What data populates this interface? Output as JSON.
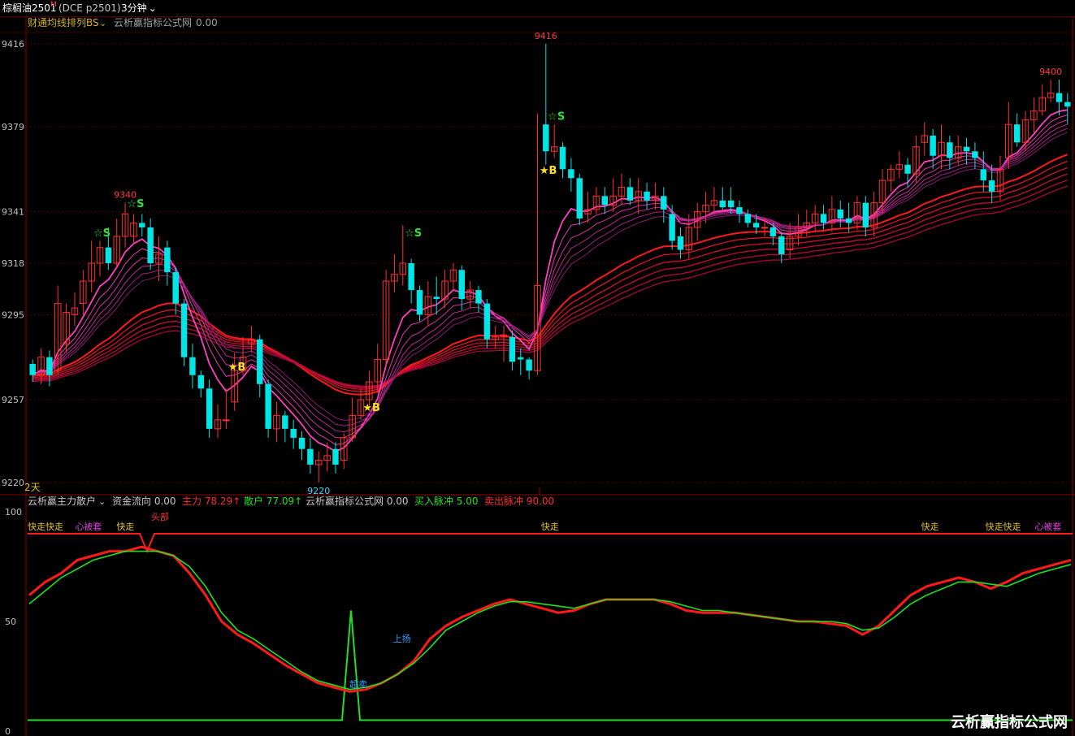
{
  "header": {
    "symbol": "棕榈油2501",
    "symbol_mark": "M",
    "contract": "(DCE  p2501)",
    "period": "3分钟"
  },
  "price_panel": {
    "indicator_name": "财通均线排列BS",
    "source_name": "云析赢指标公式网",
    "source_value": "0.00",
    "range_label": "2天"
  },
  "osc_panel": {
    "indicator_name": "云析赢主力散户",
    "legend": [
      {
        "label": "资金流向",
        "value": "0.00",
        "color": "#c8c8c8"
      },
      {
        "label": "主力",
        "value": "78.29↑",
        "color": "#ff2a2a"
      },
      {
        "label": "散户",
        "value": "77.09↑",
        "color": "#20e020"
      },
      {
        "label": "云析赢指标公式网",
        "value": "0.00",
        "color": "#c8c8c8"
      },
      {
        "label": "买入脉冲",
        "value": "5.00",
        "color": "#20e020"
      },
      {
        "label": "卖出脉冲",
        "value": "90.00",
        "color": "#ff2a2a"
      }
    ],
    "annotations": [
      {
        "text": "快走快走",
        "x": 0,
        "color": "#e0c030"
      },
      {
        "text": "心被套",
        "x": 4.8,
        "color": "#e040e0"
      },
      {
        "text": "快走",
        "x": 9,
        "color": "#e0c030"
      },
      {
        "text": "头部",
        "x": 12.5,
        "color": "#ff3030"
      },
      {
        "text": "快走",
        "x": 52,
        "color": "#e0c030"
      },
      {
        "text": "上扬",
        "x": 37,
        "color": "#30a0ff"
      },
      {
        "text": "超卖",
        "x": 32.6,
        "color": "#30a0ff"
      },
      {
        "text": "快走",
        "x": 90.5,
        "color": "#e0c030"
      },
      {
        "text": "快走快走",
        "x": 97,
        "color": "#e0c030"
      },
      {
        "text": "心被套",
        "x": 102,
        "color": "#e040e0"
      }
    ]
  },
  "watermark": "云析赢指标公式网",
  "chart_data": [
    {
      "type": "candlestick",
      "title": "财通均线排列BS",
      "yticks": [
        9220,
        9257,
        9295,
        9318,
        9341,
        9379,
        9416
      ],
      "ylim": [
        9220,
        9420
      ],
      "candles": [
        [
          9273,
          9268,
          9275,
          9265
        ],
        [
          9268,
          9276,
          9280,
          9264
        ],
        [
          9276,
          9268,
          9279,
          9263
        ],
        [
          9270,
          9300,
          9308,
          9268
        ],
        [
          9282,
          9296,
          9300,
          9278
        ],
        [
          9295,
          9298,
          9305,
          9290
        ],
        [
          9300,
          9310,
          9315,
          9295
        ],
        [
          9310,
          9318,
          9328,
          9305
        ],
        [
          9318,
          9325,
          9328,
          9312
        ],
        [
          9325,
          9318,
          9334,
          9315
        ],
        [
          9318,
          9330,
          9338,
          9316
        ],
        [
          9330,
          9340,
          9345,
          9325
        ],
        [
          9330,
          9336,
          9340,
          9327
        ],
        [
          9336,
          9334,
          9340,
          9330
        ],
        [
          9334,
          9318,
          9338,
          9315
        ],
        [
          9318,
          9322,
          9330,
          9310
        ],
        [
          9325,
          9314,
          9328,
          9308
        ],
        [
          9314,
          9300,
          9316,
          9295
        ],
        [
          9300,
          9276,
          9302,
          9272
        ],
        [
          9276,
          9268,
          9282,
          9262
        ],
        [
          9268,
          9262,
          9270,
          9258
        ],
        [
          9262,
          9244,
          9266,
          9240
        ],
        [
          9244,
          9248,
          9255,
          9240
        ],
        [
          9248,
          9248,
          9262,
          9244
        ],
        [
          9256,
          9270,
          9278,
          9252
        ],
        [
          9270,
          9276,
          9285,
          9268
        ],
        [
          9282,
          9284,
          9290,
          9278
        ],
        [
          9284,
          9264,
          9286,
          9258
        ],
        [
          9264,
          9244,
          9266,
          9240
        ],
        [
          9244,
          9250,
          9256,
          9238
        ],
        [
          9250,
          9244,
          9252,
          9238
        ],
        [
          9244,
          9240,
          9248,
          9235
        ],
        [
          9240,
          9235,
          9243,
          9230
        ],
        [
          9235,
          9228,
          9240,
          9224
        ],
        [
          9228,
          9230,
          9234,
          9220
        ],
        [
          9230,
          9232,
          9238,
          9225
        ],
        [
          9235,
          9228,
          9238,
          9224
        ],
        [
          9230,
          9240,
          9242,
          9226
        ],
        [
          9240,
          9250,
          9258,
          9238
        ],
        [
          9250,
          9257,
          9262,
          9248
        ],
        [
          9257,
          9265,
          9270,
          9254
        ],
        [
          9265,
          9275,
          9282,
          9260
        ],
        [
          9275,
          9310,
          9315,
          9272
        ],
        [
          9310,
          9313,
          9322,
          9305
        ],
        [
          9313,
          9318,
          9335,
          9308
        ],
        [
          9318,
          9306,
          9320,
          9300
        ],
        [
          9306,
          9295,
          9308,
          9292
        ],
        [
          9295,
          9303,
          9310,
          9290
        ],
        [
          9303,
          9302,
          9312,
          9295
        ],
        [
          9302,
          9310,
          9315,
          9298
        ],
        [
          9310,
          9315,
          9318,
          9306
        ],
        [
          9315,
          9302,
          9317,
          9297
        ],
        [
          9302,
          9306,
          9310,
          9298
        ],
        [
          9306,
          9300,
          9308,
          9296
        ],
        [
          9300,
          9284,
          9302,
          9280
        ],
        [
          9284,
          9285,
          9290,
          9280
        ],
        [
          9285,
          9286,
          9290,
          9274
        ],
        [
          9285,
          9274,
          9288,
          9270
        ],
        [
          9276,
          9275,
          9280,
          9268
        ],
        [
          9275,
          9270,
          9276,
          9266
        ],
        [
          9270,
          9308,
          9385,
          9268
        ],
        [
          9380,
          9368,
          9416,
          9362
        ],
        [
          9368,
          9370,
          9380,
          9365
        ],
        [
          9370,
          9360,
          9372,
          9356
        ],
        [
          9360,
          9356,
          9365,
          9350
        ],
        [
          9356,
          9338,
          9358,
          9335
        ],
        [
          9340,
          9342,
          9350,
          9336
        ],
        [
          9342,
          9348,
          9352,
          9340
        ],
        [
          9348,
          9344,
          9352,
          9340
        ],
        [
          9344,
          9348,
          9356,
          9341
        ],
        [
          9348,
          9352,
          9358,
          9344
        ],
        [
          9352,
          9346,
          9356,
          9344
        ],
        [
          9346,
          9350,
          9356,
          9340
        ],
        [
          9350,
          9346,
          9354,
          9342
        ],
        [
          9346,
          9348,
          9354,
          9342
        ],
        [
          9348,
          9342,
          9352,
          9336
        ],
        [
          9340,
          9328,
          9344,
          9324
        ],
        [
          9330,
          9324,
          9334,
          9320
        ],
        [
          9324,
          9334,
          9340,
          9320
        ],
        [
          9334,
          9341,
          9345,
          9328
        ],
        [
          9341,
          9344,
          9350,
          9336
        ],
        [
          9344,
          9346,
          9352,
          9340
        ],
        [
          9346,
          9343,
          9352,
          9342
        ],
        [
          9346,
          9343,
          9352,
          9340
        ],
        [
          9343,
          9340,
          9346,
          9336
        ],
        [
          9340,
          9336,
          9342,
          9334
        ],
        [
          9336,
          9334,
          9340,
          9331
        ],
        [
          9334,
          9334,
          9338,
          9330
        ],
        [
          9334,
          9330,
          9336,
          9326
        ],
        [
          9330,
          9322,
          9332,
          9318
        ],
        [
          9324,
          9330,
          9336,
          9320
        ],
        [
          9330,
          9334,
          9340,
          9326
        ],
        [
          9334,
          9336,
          9342,
          9330
        ],
        [
          9336,
          9340,
          9344,
          9332
        ],
        [
          9340,
          9336,
          9344,
          9333
        ],
        [
          9336,
          9342,
          9348,
          9332
        ],
        [
          9342,
          9338,
          9346,
          9334
        ],
        [
          9338,
          9336,
          9345,
          9332
        ],
        [
          9336,
          9345,
          9348,
          9333
        ],
        [
          9345,
          9334,
          9348,
          9330
        ],
        [
          9334,
          9345,
          9350,
          9330
        ],
        [
          9345,
          9355,
          9360,
          9340
        ],
        [
          9355,
          9360,
          9362,
          9350
        ],
        [
          9360,
          9362,
          9368,
          9356
        ],
        [
          9362,
          9358,
          9365,
          9352
        ],
        [
          9358,
          9370,
          9375,
          9354
        ],
        [
          9372,
          9375,
          9381,
          9366
        ],
        [
          9375,
          9366,
          9378,
          9360
        ],
        [
          9366,
          9372,
          9380,
          9360
        ],
        [
          9372,
          9365,
          9375,
          9360
        ],
        [
          9365,
          9370,
          9375,
          9362
        ],
        [
          9370,
          9368,
          9374,
          9362
        ],
        [
          9368,
          9365,
          9372,
          9360
        ],
        [
          9360,
          9355,
          9368,
          9350
        ],
        [
          9355,
          9350,
          9362,
          9345
        ],
        [
          9350,
          9360,
          9366,
          9346
        ],
        [
          9365,
          9380,
          9390,
          9360
        ],
        [
          9380,
          9372,
          9385,
          9370
        ],
        [
          9372,
          9382,
          9386,
          9368
        ],
        [
          9382,
          9386,
          9392,
          9376
        ],
        [
          9386,
          9392,
          9398,
          9384
        ],
        [
          9392,
          9394,
          9400,
          9390
        ],
        [
          9394,
          9390,
          9400,
          9384
        ],
        [
          9390,
          9388,
          9394,
          9380
        ]
      ],
      "highlights": [
        {
          "kind": "high",
          "label": "9416",
          "candle": 61
        },
        {
          "kind": "high",
          "label": "9340",
          "candle": 11
        },
        {
          "kind": "low",
          "label": "9220",
          "candle": 34
        },
        {
          "kind": "high",
          "label": "9400",
          "candle": 121
        }
      ],
      "signals": [
        {
          "type": "S",
          "candle": 8,
          "price": 9330
        },
        {
          "type": "S",
          "candle": 12,
          "price": 9343
        },
        {
          "type": "B",
          "candle": 24,
          "price": 9270
        },
        {
          "type": "B",
          "candle": 40,
          "price": 9252
        },
        {
          "type": "S",
          "candle": 45,
          "price": 9330
        },
        {
          "type": "B",
          "candle": 61,
          "price": 9358
        },
        {
          "type": "S",
          "candle": 62,
          "price": 9382
        }
      ]
    },
    {
      "type": "line",
      "title": "云析赢主力散户",
      "ylim": [
        0,
        100
      ],
      "yticks": [
        0,
        50,
        100
      ],
      "series": [
        {
          "name": "主力",
          "color": "#ff1a1a",
          "values": [
            62,
            68,
            72,
            78,
            80,
            82,
            82,
            84,
            82,
            80,
            72,
            62,
            50,
            44,
            40,
            35,
            30,
            26,
            22,
            20,
            18,
            19,
            22,
            26,
            32,
            42,
            48,
            52,
            55,
            58,
            60,
            58,
            56,
            54,
            55,
            58,
            60,
            60,
            60,
            60,
            58,
            55,
            54,
            54,
            54,
            53,
            52,
            51,
            50,
            50,
            49,
            48,
            44,
            48,
            55,
            62,
            66,
            68,
            70,
            68,
            65,
            68,
            72,
            74,
            76,
            78
          ]
        },
        {
          "name": "散户",
          "color": "#20e020",
          "values": [
            58,
            64,
            70,
            74,
            78,
            80,
            82,
            82,
            82,
            80,
            75,
            66,
            54,
            46,
            42,
            37,
            32,
            27,
            23,
            21,
            19,
            20,
            22,
            26,
            31,
            38,
            46,
            50,
            54,
            57,
            59,
            59,
            58,
            57,
            56,
            58,
            60,
            60,
            60,
            60,
            59,
            57,
            55,
            55,
            54,
            53,
            52,
            51,
            50,
            50,
            50,
            49,
            46,
            47,
            52,
            58,
            62,
            65,
            68,
            68,
            67,
            66,
            69,
            72,
            74,
            76
          ]
        }
      ]
    }
  ]
}
